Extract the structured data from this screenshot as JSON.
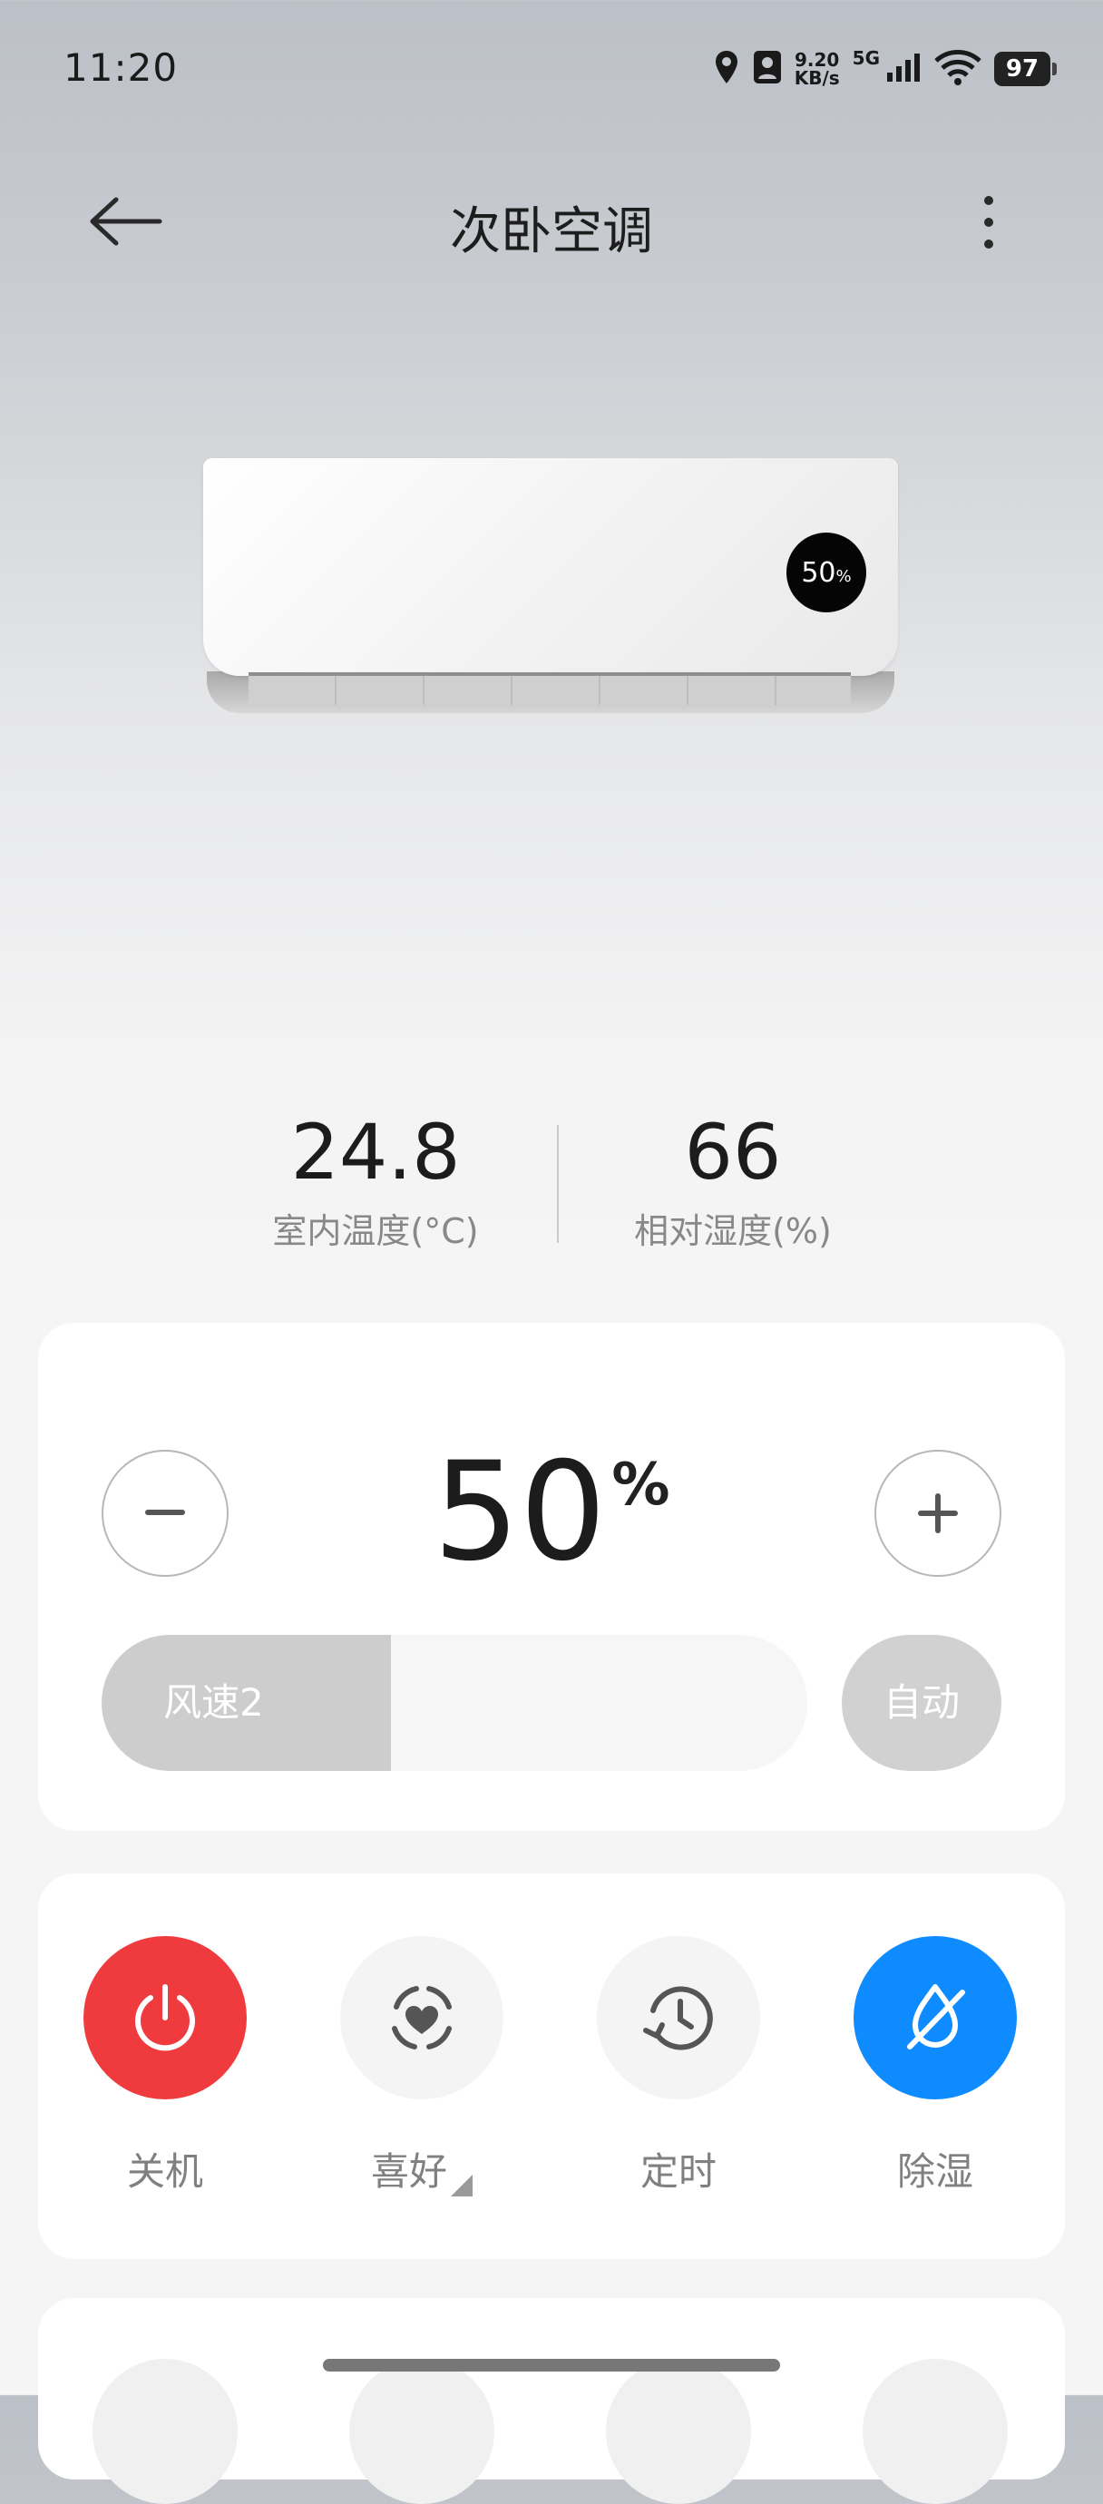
{
  "status_bar": {
    "time": "11:20",
    "net_speed_value": "9.20",
    "net_speed_unit": "KB/s",
    "network": "5G",
    "battery": "97"
  },
  "header": {
    "title": "次卧空调"
  },
  "device": {
    "display_value": "50",
    "display_unit": "%"
  },
  "readings": [
    {
      "value": "24.8",
      "label": "室内温度(°C)"
    },
    {
      "value": "66",
      "label": "相对湿度(%)"
    }
  ],
  "control": {
    "value": "50",
    "unit": "%",
    "minus_label": "−",
    "plus_label": "+",
    "fan_speed_label": "风速2",
    "fan_speed_level": 0.41,
    "auto_label": "自动"
  },
  "functions": [
    {
      "label": "关机",
      "icon": "power-icon",
      "color": "#ef3b3e"
    },
    {
      "label": "喜好",
      "icon": "heart-icon",
      "color": "#f4f4f4"
    },
    {
      "label": "定时",
      "icon": "timer-icon",
      "color": "#f4f4f4"
    },
    {
      "label": "除湿",
      "icon": "dehumidify-icon",
      "color": "#0d8bff"
    }
  ]
}
